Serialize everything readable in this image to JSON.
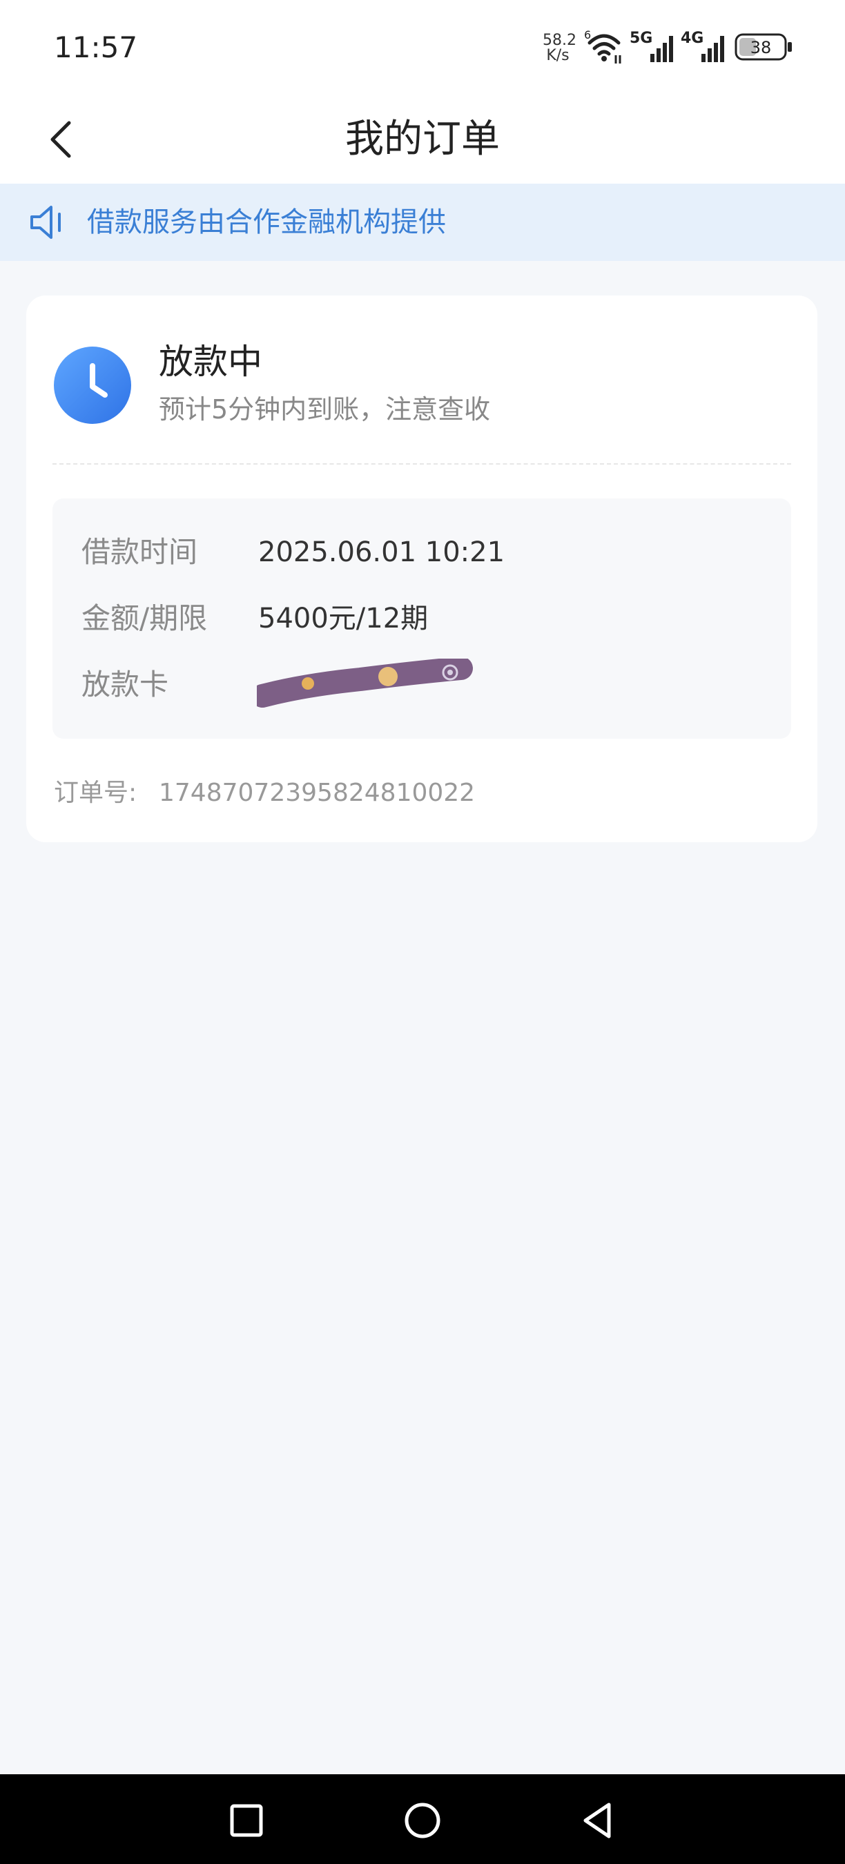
{
  "status_bar": {
    "time": "11:57",
    "net_speed_value": "58.2",
    "net_speed_unit": "K/s",
    "wifi_badge": "6",
    "signal_1_label": "5G",
    "signal_2_label": "4G",
    "battery_level": "38"
  },
  "nav": {
    "title": "我的订单",
    "back_icon": "chevron-left-icon"
  },
  "notice": {
    "icon": "speaker-icon",
    "text": "借款服务由合作金融机构提供",
    "color": "#3a7fd5"
  },
  "order": {
    "status_icon": "clock-icon",
    "status_title": "放款中",
    "status_desc": "预计5分钟内到账，注意查收",
    "details": [
      {
        "label": "借款时间",
        "value": "2025.06.01 10:21"
      },
      {
        "label": "金额/期限",
        "value": "5400元/12期"
      },
      {
        "label": "放款卡",
        "value": ""
      }
    ],
    "order_no_label": "订单号:",
    "order_no": "17487072395824810022"
  },
  "system_nav": {
    "recents_icon": "square-icon",
    "home_icon": "circle-icon",
    "back_icon": "triangle-back-icon"
  },
  "colors": {
    "accent": "#3a7fd5",
    "clock_gradient_start": "#5ea6ff",
    "clock_gradient_end": "#2f73e6",
    "page_bg": "#f5f7fa"
  }
}
